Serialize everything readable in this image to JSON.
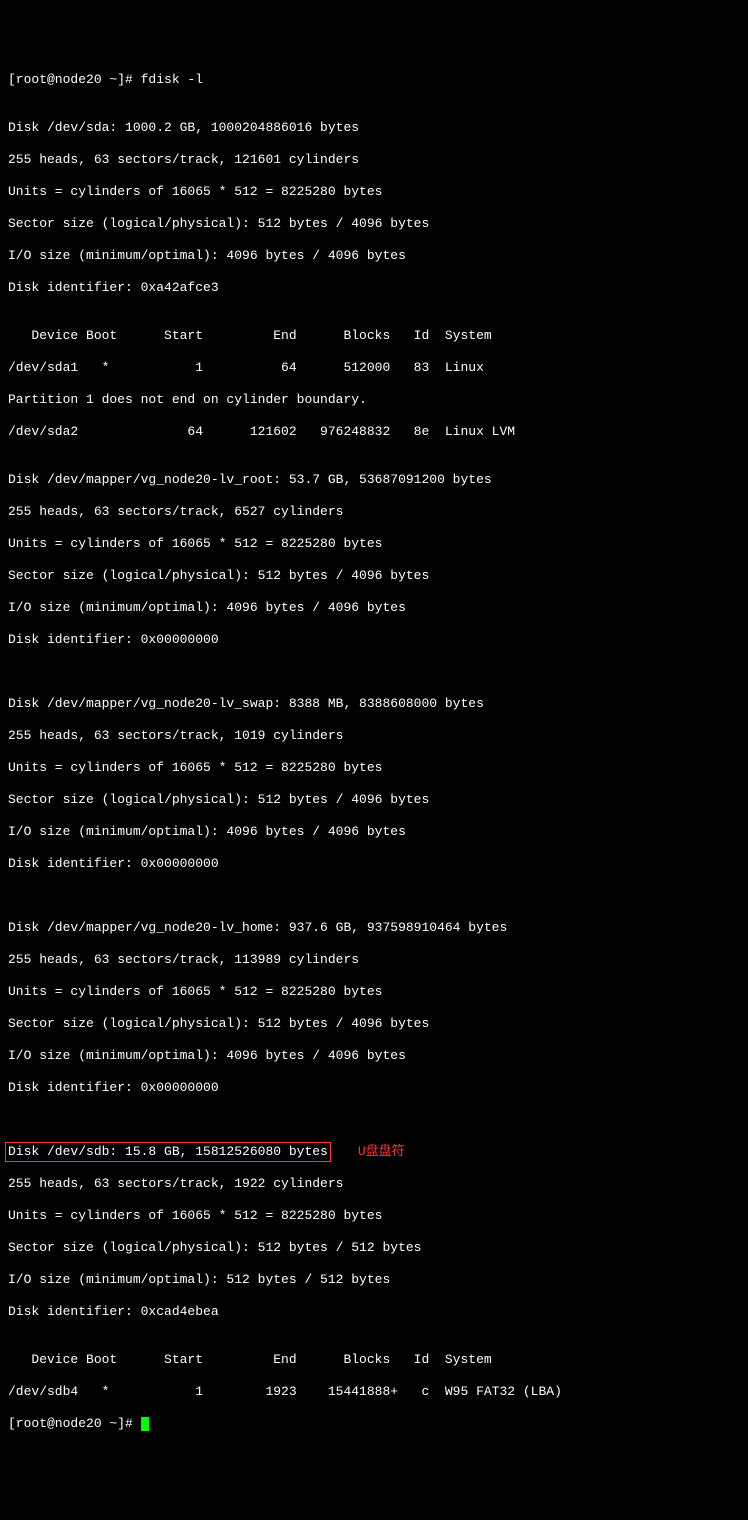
{
  "prompt1": "[root@node20 ~]# ",
  "cmd1": "fdisk -l",
  "blank": "",
  "sda": {
    "header": "Disk /dev/sda: 1000.2 GB, 1000204886016 bytes",
    "geom": "255 heads, 63 sectors/track, 121601 cylinders",
    "units": "Units = cylinders of 16065 * 512 = 8225280 bytes",
    "sector": "Sector size (logical/physical): 512 bytes / 4096 bytes",
    "io": "I/O size (minimum/optimal): 4096 bytes / 4096 bytes",
    "id": "Disk identifier: 0xa42afce3",
    "thead": "   Device Boot      Start         End      Blocks   Id  System",
    "row1": "/dev/sda1   *           1          64      512000   83  Linux",
    "warn": "Partition 1 does not end on cylinder boundary.",
    "row2": "/dev/sda2              64      121602   976248832   8e  Linux LVM"
  },
  "lv_root": {
    "header": "Disk /dev/mapper/vg_node20-lv_root: 53.7 GB, 53687091200 bytes",
    "geom": "255 heads, 63 sectors/track, 6527 cylinders",
    "units": "Units = cylinders of 16065 * 512 = 8225280 bytes",
    "sector": "Sector size (logical/physical): 512 bytes / 4096 bytes",
    "io": "I/O size (minimum/optimal): 4096 bytes / 4096 bytes",
    "id": "Disk identifier: 0x00000000"
  },
  "lv_swap": {
    "header": "Disk /dev/mapper/vg_node20-lv_swap: 8388 MB, 8388608000 bytes",
    "geom": "255 heads, 63 sectors/track, 1019 cylinders",
    "units": "Units = cylinders of 16065 * 512 = 8225280 bytes",
    "sector": "Sector size (logical/physical): 512 bytes / 4096 bytes",
    "io": "I/O size (minimum/optimal): 4096 bytes / 4096 bytes",
    "id": "Disk identifier: 0x00000000"
  },
  "lv_home": {
    "header": "Disk /dev/mapper/vg_node20-lv_home: 937.6 GB, 937598910464 bytes",
    "geom": "255 heads, 63 sectors/track, 113989 cylinders",
    "units": "Units = cylinders of 16065 * 512 = 8225280 bytes",
    "sector": "Sector size (logical/physical): 512 bytes / 4096 bytes",
    "io": "I/O size (minimum/optimal): 4096 bytes / 4096 bytes",
    "id": "Disk identifier: 0x00000000"
  },
  "sdb": {
    "header": "Disk /dev/sdb: 15.8 GB, 15812526080 bytes",
    "annotation": "U盘盘符",
    "geom": "255 heads, 63 sectors/track, 1922 cylinders",
    "units": "Units = cylinders of 16065 * 512 = 8225280 bytes",
    "sector": "Sector size (logical/physical): 512 bytes / 512 bytes",
    "io": "I/O size (minimum/optimal): 512 bytes / 512 bytes",
    "id": "Disk identifier: 0xcad4ebea",
    "thead": "   Device Boot      Start         End      Blocks   Id  System",
    "row1": "/dev/sdb4   *           1        1923    15441888+   c  W95 FAT32 (LBA)"
  },
  "prompt2": "[root@node20 ~]# "
}
